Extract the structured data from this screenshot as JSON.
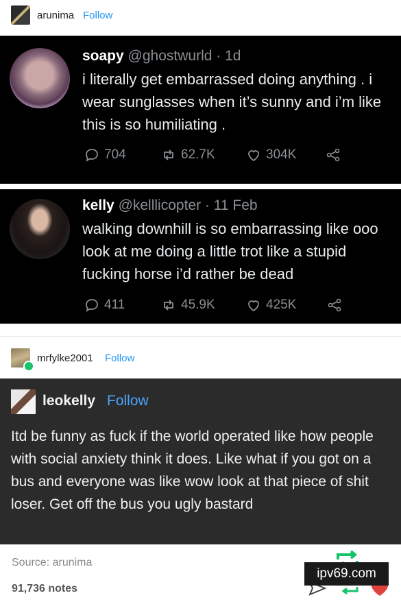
{
  "post1": {
    "username": "arunima",
    "follow_label": "Follow"
  },
  "tweet1": {
    "display_name": "soapy",
    "handle_time": "@ghostwurld · 1d",
    "text": "i literally get embarrassed doing anything . i wear sunglasses when it’s sunny and i’m like this is so humiliating .",
    "replies": "704",
    "retweets": "62.7K",
    "likes": "304K"
  },
  "tweet2": {
    "display_name": "kelly",
    "handle_time": "@kelllicopter · 11 Feb",
    "text": "walking downhill is so embarrassing like ooo look at me doing a little trot like a stupid fucking horse i’d rather be dead",
    "replies": "411",
    "retweets": "45.9K",
    "likes": "425K"
  },
  "post2": {
    "username": "mrfylke2001",
    "follow_label": "Follow"
  },
  "quote": {
    "username": "leokelly",
    "follow_label": "Follow",
    "text": "Itd be funny as fuck if the world operated  like how people with social anxiety  think it does. Like what if you got on a bus and everyone was like wow look at that piece of shit loser. Get  off the bus you ugly bastard"
  },
  "footer": {
    "source": "Source: arunima",
    "notes": "91,736 notes",
    "watermark": "ipv69.com"
  },
  "colors": {
    "follow_blue": "#2196f3",
    "reblog_green": "#19c36b",
    "like_red": "#e0423b"
  }
}
